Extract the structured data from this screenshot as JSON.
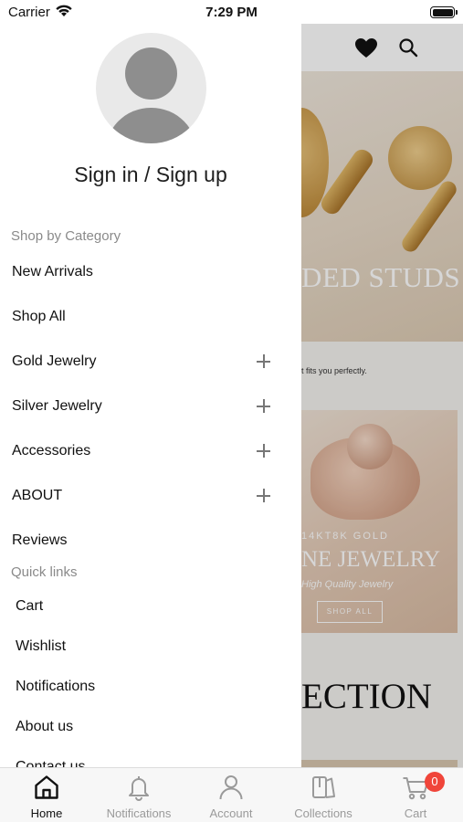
{
  "status_bar": {
    "carrier": "Carrier",
    "time": "7:29 PM",
    "icons": [
      "wifi-icon",
      "battery-icon"
    ]
  },
  "background_page": {
    "header_icons": [
      "heart-icon",
      "search-icon"
    ],
    "hero_text": "DED STUDS",
    "caption": "t fits you perfectly.",
    "banner": {
      "small_text": "14KT8K GOLD",
      "title": "NE JEWELRY",
      "subtitle": "High Quality Jewelry",
      "button_label": "SHOP ALL"
    },
    "section_title": "ECTION"
  },
  "drawer": {
    "avatar_icon": "user-avatar-icon",
    "sign_in_label": "Sign in / Sign up",
    "shop_by_category_header": "Shop by Category",
    "categories": [
      {
        "label": "New Arrivals",
        "expandable": false
      },
      {
        "label": "Shop All",
        "expandable": false
      },
      {
        "label": "Gold Jewelry",
        "expandable": true
      },
      {
        "label": "Silver Jewelry",
        "expandable": true
      },
      {
        "label": "Accessories",
        "expandable": true
      },
      {
        "label": "ABOUT",
        "expandable": true
      },
      {
        "label": "Reviews",
        "expandable": false
      }
    ],
    "quick_links_header": "Quick links",
    "quick_links": [
      "Cart",
      "Wishlist",
      "Notifications",
      "About us",
      "Contact us"
    ]
  },
  "tab_bar": {
    "tabs": [
      {
        "label": "Home",
        "icon": "home-icon",
        "active": true
      },
      {
        "label": "Notifications",
        "icon": "bell-icon",
        "active": false
      },
      {
        "label": "Account",
        "icon": "person-icon",
        "active": false
      },
      {
        "label": "Collections",
        "icon": "collections-icon",
        "active": false
      },
      {
        "label": "Cart",
        "icon": "cart-icon",
        "active": false
      }
    ],
    "cart_badge": "0"
  },
  "colors": {
    "badge": "#f0453a",
    "active_tab": "#111111",
    "inactive_tab": "#9a9a9a",
    "section_header": "#8a8a8a",
    "avatar_fill": "#8e8e8e"
  }
}
